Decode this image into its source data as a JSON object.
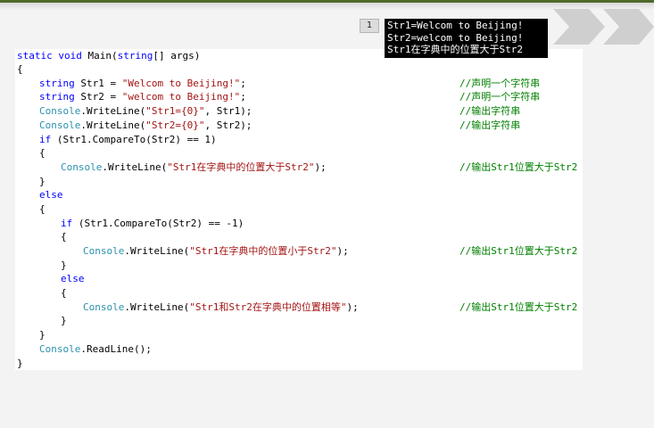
{
  "slide": {
    "number": "1"
  },
  "console_output": [
    "Str1=Welcom to Beijing!",
    "Str2=welcom to Beijing!",
    "Str1在字典中的位置大于Str2"
  ],
  "code": {
    "line1": {
      "kw": "static void",
      "rest": " Main(",
      "kw2": "string",
      "rest2": "[] args)"
    },
    "line2": "{",
    "line3": {
      "kw": "string",
      "rest": " Str1 = ",
      "str": "\"Welcom to Beijing!\"",
      "end": ";"
    },
    "line4": {
      "kw": "string",
      "rest": " Str2 = ",
      "str": "\"welcom to Beijing!\"",
      "end": ";"
    },
    "line5": {
      "cls": "Console",
      "rest": ".WriteLine(",
      "str": "\"Str1={0}\"",
      "end": ", Str1);"
    },
    "line6": {
      "cls": "Console",
      "rest": ".WriteLine(",
      "str": "\"Str2={0}\"",
      "end": ", Str2);"
    },
    "line7": {
      "kw": "if",
      "rest": " (Str1.CompareTo(Str2) == 1)"
    },
    "line8": "{",
    "line9": {
      "cls": "Console",
      "rest": ".WriteLine(",
      "str": "\"Str1在字典中的位置大于Str2\"",
      "end": ");"
    },
    "line10": "}",
    "line11": {
      "kw": "else"
    },
    "line12": "{",
    "line13": {
      "kw": "if",
      "rest": " (Str1.CompareTo(Str2) == -1)"
    },
    "line14": "{",
    "line15": {
      "cls": "Console",
      "rest": ".WriteLine(",
      "str": "\"Str1在字典中的位置小于Str2\"",
      "end": ");"
    },
    "line16": "}",
    "line17": {
      "kw": "else"
    },
    "line18": "{",
    "line19": {
      "cls": "Console",
      "rest": ".WriteLine(",
      "str": "\"Str1和Str2在字典中的位置相等\"",
      "end": ");"
    },
    "line20": "}",
    "line21": "}",
    "line22": {
      "cls": "Console",
      "rest": ".ReadLine();"
    },
    "line23": "}"
  },
  "comments": {
    "declare1": "//声明一个字符串",
    "declare2": "//声明一个字符串",
    "output1": "//输出字符串",
    "output2": "//输出字符串",
    "greater": "//输出Str1位置大于Str2",
    "less": "//输出Str1位置大于Str2",
    "equal": "//输出Str1位置大于Str2"
  },
  "colors": {
    "keyword": "#0000ff",
    "type": "#2b91af",
    "string": "#a31515",
    "comment": "#008000",
    "accent_bar": "#4f6a2a",
    "chevron": "#cfcfcf"
  },
  "icons": [
    "chevron-right-icon",
    "chevron-right-icon"
  ]
}
